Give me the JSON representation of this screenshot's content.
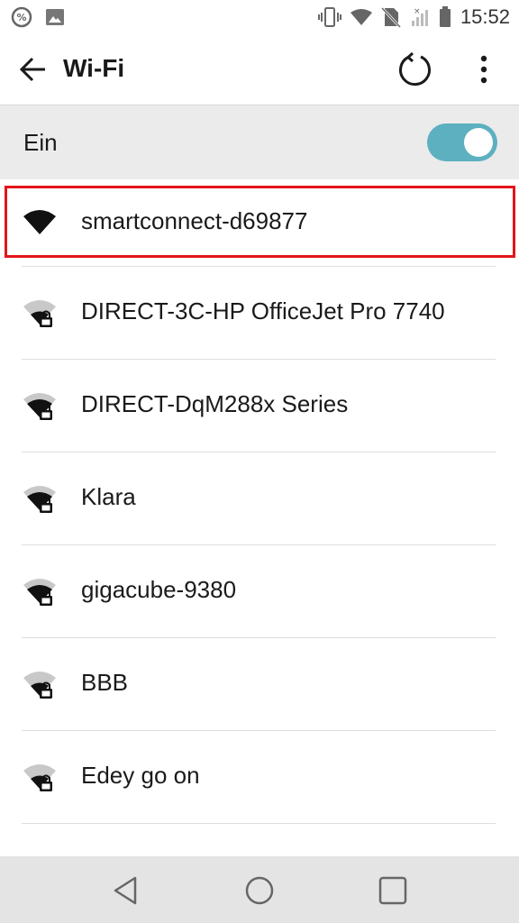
{
  "status_bar": {
    "time": "15:52",
    "icons": [
      "percent-badge-icon",
      "image-icon",
      "vibrate-icon",
      "wifi-icon",
      "no-sim-icon",
      "no-signal-icon",
      "battery-icon"
    ]
  },
  "app_bar": {
    "title": "Wi-Fi",
    "icons": [
      "back-arrow-icon",
      "refresh-icon",
      "more-vert-icon"
    ]
  },
  "wifi_toggle": {
    "label": "Ein",
    "state": "on",
    "accent_color": "#5cb0bf"
  },
  "networks": [
    {
      "name": "smartconnect-d69877",
      "secured": false,
      "highlighted": true
    },
    {
      "name": "DIRECT-3C-HP OfficeJet Pro 7740",
      "secured": true
    },
    {
      "name": "DIRECT-DqM288x Series",
      "secured": true
    },
    {
      "name": "Klara",
      "secured": true
    },
    {
      "name": "gigacube-9380",
      "secured": true
    },
    {
      "name": "BBB",
      "secured": true
    },
    {
      "name": "Edey go on",
      "secured": true
    }
  ],
  "nav_bar": {
    "icons": [
      "back-triangle-icon",
      "home-circle-icon",
      "recents-square-icon"
    ]
  },
  "colors": {
    "highlight_border": "#e3151a",
    "toggle_row_bg": "#ebebeb",
    "nav_bar_bg": "#e4e4e4"
  }
}
